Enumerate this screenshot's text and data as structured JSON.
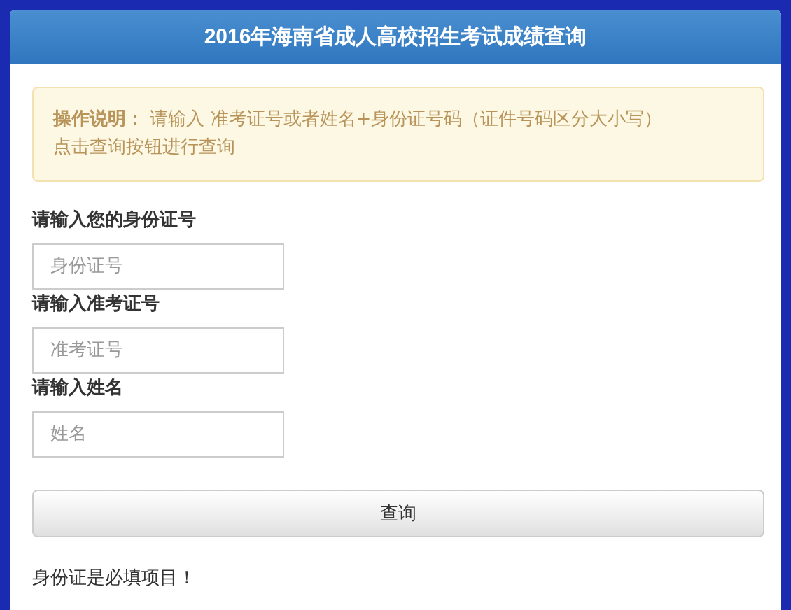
{
  "header": {
    "title": "2016年海南省成人高校招生考试成绩查询"
  },
  "notice": {
    "lines": [
      "**操作说明：** 请输入 准考证号或者姓名+身份证号码（证件号码区分大小写）",
      "点击查询按钮进行查询"
    ]
  },
  "fields": [
    {
      "label": "请输入您的身份证号",
      "placeholder": "身份证号"
    },
    {
      "label": "请输入准考证号",
      "placeholder": "准考证号"
    },
    {
      "label": "请输入姓名",
      "placeholder": "姓名"
    }
  ],
  "submit": {
    "label": "查询"
  },
  "message": "身份证是必填项目！"
}
